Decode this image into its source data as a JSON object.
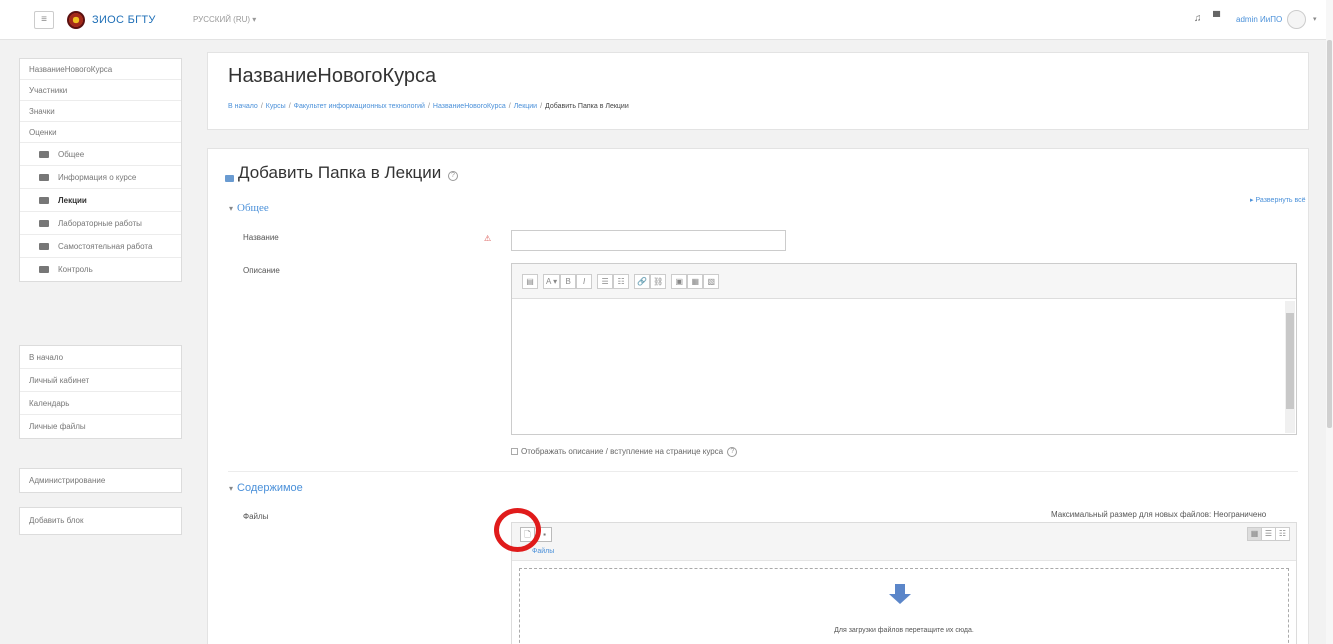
{
  "navbar": {
    "menu_icon": "hamburger-icon",
    "site_name": "ЗИОС БГТУ",
    "language": "РУССКИЙ (RU) ▾",
    "user_name": "admin ИиПО",
    "caret": "▾"
  },
  "sidebar": {
    "course_nav": [
      {
        "label": "НазваниеНовогоКурса",
        "type": "link"
      },
      {
        "label": "Участники",
        "type": "link"
      },
      {
        "label": "Значки",
        "type": "link"
      },
      {
        "label": "Оценки",
        "type": "link"
      },
      {
        "label": "Общее",
        "type": "section"
      },
      {
        "label": "Информация о курсе",
        "type": "section"
      },
      {
        "label": "Лекции",
        "type": "section",
        "active": true
      },
      {
        "label": "Лабораторные работы",
        "type": "section"
      },
      {
        "label": "Самостоятельная работа",
        "type": "section"
      },
      {
        "label": "Контроль",
        "type": "section"
      }
    ],
    "site_nav": [
      "В начало",
      "Личный кабинет",
      "Календарь",
      "Личные файлы"
    ],
    "admin": "Администрирование",
    "add_block": "Добавить блок"
  },
  "header": {
    "title": "НазваниеНовогоКурса",
    "breadcrumb": [
      "В начало",
      "Курсы",
      "Факультет информационных технологий",
      "НазваниеНовогоКурса",
      "Лекции",
      "Добавить Папка в Лекции"
    ]
  },
  "form": {
    "title": "Добавить Папка в Лекции",
    "help": "?",
    "expand_all": "▸ Развернуть всё",
    "section_general": "Общее",
    "name_label": "Название",
    "required_marker": "⚠",
    "name_value": "",
    "description_label": "Описание",
    "toolbar": [
      "▤",
      "A ▾",
      "B",
      "I",
      "☰",
      "☷",
      "🔗",
      "⛓",
      "▣",
      "▦",
      "▧"
    ],
    "show_description": "Отображать описание / вступление на странице курса",
    "section_content": "Содержимое",
    "files_label": "Файлы",
    "max_size": "Максимальный размер для новых файлов: Неограничено",
    "path": "Файлы",
    "drop_text": "Для загрузки файлов перетащите их сюда."
  }
}
